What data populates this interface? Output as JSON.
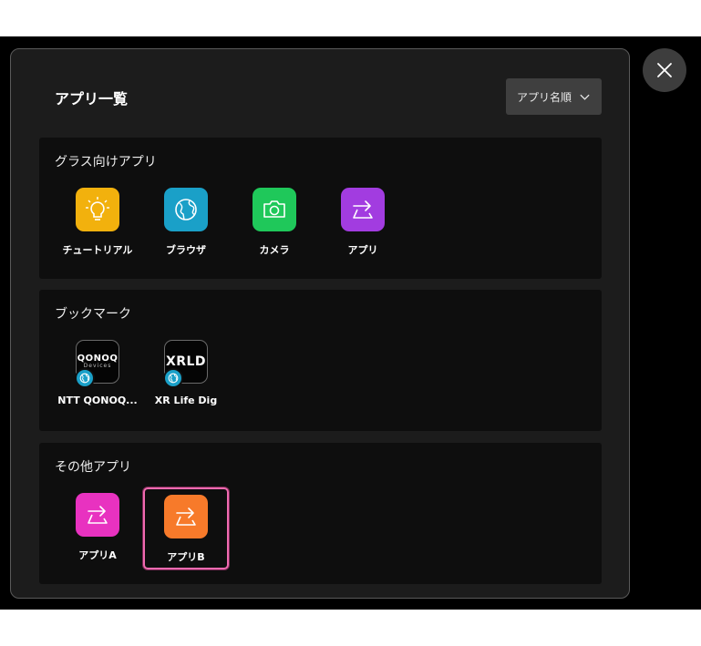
{
  "panel": {
    "title": "アプリ一覧",
    "sort_label": "アプリ名順",
    "sort_icon": "chevron-down-icon"
  },
  "close_icon": "close-icon",
  "sections": [
    {
      "title": "グラス向けアプリ",
      "apps": [
        {
          "label": "チュートリアル",
          "icon": "lightbulb-icon",
          "color": "#f2b10d"
        },
        {
          "label": "ブラウザ",
          "icon": "globe-icon",
          "color": "#1aa0c8"
        },
        {
          "label": "カメラ",
          "icon": "camera-icon",
          "color": "#1fc85a"
        },
        {
          "label": "アプリ",
          "icon": "app-arrow-icon",
          "color": "#a23ce0"
        }
      ]
    },
    {
      "title": "ブックマーク",
      "apps": [
        {
          "label": "NTT QONOQ...",
          "icon": "qonoq-logo",
          "logo_text": "QONOQ",
          "logo_sub": "Devices",
          "badge": "globe-icon"
        },
        {
          "label": "XR Life Dig",
          "icon": "xrld-logo",
          "logo_text": "XRLD",
          "badge": "globe-icon"
        }
      ]
    },
    {
      "title": "その他アプリ",
      "apps": [
        {
          "label": "アプリA",
          "icon": "app-arrow-icon",
          "color": "#e832c0"
        },
        {
          "label": "アプリB",
          "icon": "app-arrow-icon",
          "color": "#f77a2a",
          "selected": true
        }
      ]
    }
  ]
}
